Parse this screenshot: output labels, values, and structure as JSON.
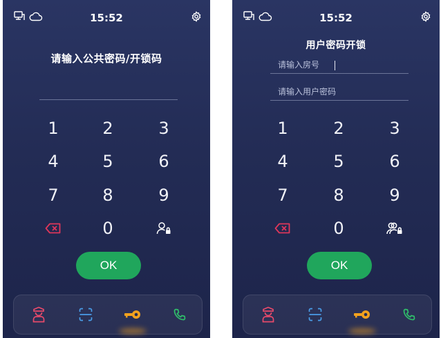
{
  "screens": [
    {
      "status": {
        "time": "15:52"
      },
      "title": "请输入公共密码/开锁码",
      "keys": [
        "1",
        "2",
        "3",
        "4",
        "5",
        "6",
        "7",
        "8",
        "9",
        "0"
      ],
      "ok_label": "OK"
    },
    {
      "status": {
        "time": "15:52"
      },
      "title": "用户密码开锁",
      "room_placeholder": "请输入房号",
      "password_placeholder": "请输入用户密码",
      "keys": [
        "1",
        "2",
        "3",
        "4",
        "5",
        "6",
        "7",
        "8",
        "9",
        "0"
      ],
      "ok_label": "OK"
    }
  ],
  "colors": {
    "background": "#232c55",
    "ok_button": "#20a65c",
    "delete_icon": "#e0365a",
    "key_icon": "#f2a11e",
    "phone_icon": "#2fbf6a",
    "scan_icon": "#4a9de8",
    "guard_icon": "#e84a6a"
  },
  "icons": {
    "status_left": [
      "monitor-network-icon",
      "cloud-icon"
    ],
    "status_right": "settings-gear-icon",
    "backspace": "backspace-icon",
    "user_lock_left": "user-lock-icon",
    "user_lock_right": "users-lock-icon",
    "dock": [
      "security-guard-icon",
      "qr-scan-icon",
      "key-icon",
      "phone-icon"
    ]
  }
}
